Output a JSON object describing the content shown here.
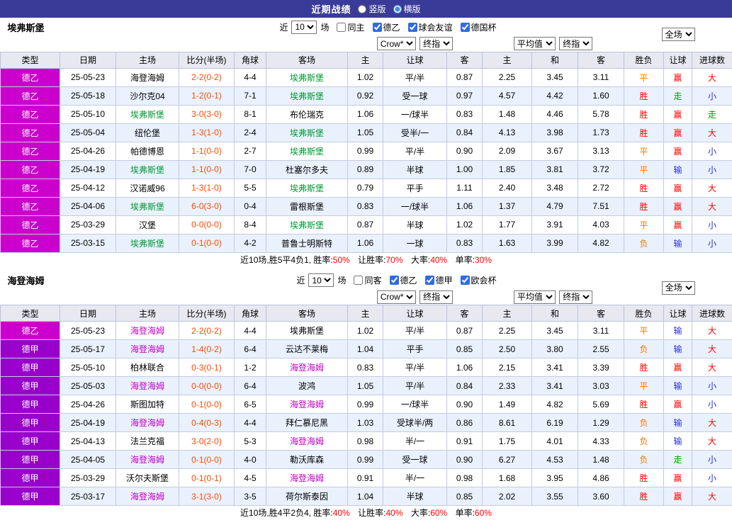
{
  "topbar": {
    "title": "近期战绩",
    "vertical_label": "竖版",
    "vertical_checked": false,
    "horizontal_label": "横版",
    "horizontal_checked": true
  },
  "controls": {
    "near_label": "近",
    "count_value": "10",
    "matches_label": "场",
    "bookmaker_select": "Crow*",
    "final_odds_select": "终指",
    "average_select": "平均值",
    "scope_select": "全场"
  },
  "columns": [
    "类型",
    "日期",
    "主场",
    "比分(半场)",
    "角球",
    "客场",
    "主",
    "让球",
    "客",
    "主",
    "和",
    "客",
    "胜负",
    "让球",
    "进球数"
  ],
  "sections": [
    {
      "team": "埃弗斯堡",
      "filters": [
        {
          "label": "同主",
          "checked": false
        },
        {
          "label": "德乙",
          "checked": true
        },
        {
          "label": "球会友谊",
          "checked": true
        },
        {
          "label": "德国杯",
          "checked": true
        }
      ],
      "rows": [
        {
          "league": "德乙",
          "league_cls": "lg-de2",
          "date": "25-05-23",
          "home": "海登海姆",
          "home_cls": "",
          "score": "2-2(0-2)",
          "corners": "4-4",
          "away": "埃弗斯堡",
          "away_cls": "t-green",
          "ah_home": "1.02",
          "ah_line": "平/半",
          "ah_away": "0.87",
          "eu_home": "2.25",
          "eu_draw": "3.45",
          "eu_away": "3.11",
          "result": "平",
          "result_cls": "c-orange",
          "hcp": "赢",
          "hcp_cls": "c-red",
          "goals": "大",
          "goals_cls": "c-red"
        },
        {
          "league": "德乙",
          "league_cls": "lg-de2",
          "date": "25-05-18",
          "home": "沙尔克04",
          "home_cls": "",
          "score": "1-2(0-1)",
          "corners": "7-1",
          "away": "埃弗斯堡",
          "away_cls": "t-green",
          "ah_home": "0.92",
          "ah_line": "受一球",
          "ah_away": "0.97",
          "eu_home": "4.57",
          "eu_draw": "4.42",
          "eu_away": "1.60",
          "result": "胜",
          "result_cls": "c-red",
          "hcp": "走",
          "hcp_cls": "c-green",
          "goals": "小",
          "goals_cls": "c-blue"
        },
        {
          "league": "德乙",
          "league_cls": "lg-de2",
          "date": "25-05-10",
          "home": "埃弗斯堡",
          "home_cls": "t-green",
          "score": "3-0(3-0)",
          "corners": "8-1",
          "away": "布伦瑞克",
          "away_cls": "",
          "ah_home": "1.06",
          "ah_line": "一/球半",
          "ah_away": "0.83",
          "eu_home": "1.48",
          "eu_draw": "4.46",
          "eu_away": "5.78",
          "result": "胜",
          "result_cls": "c-red",
          "hcp": "赢",
          "hcp_cls": "c-red",
          "goals": "走",
          "goals_cls": "c-green"
        },
        {
          "league": "德乙",
          "league_cls": "lg-de2",
          "date": "25-05-04",
          "home": "纽伦堡",
          "home_cls": "",
          "score": "1-3(1-0)",
          "corners": "2-4",
          "away": "埃弗斯堡",
          "away_cls": "t-green",
          "ah_home": "1.05",
          "ah_line": "受半/一",
          "ah_away": "0.84",
          "eu_home": "4.13",
          "eu_draw": "3.98",
          "eu_away": "1.73",
          "result": "胜",
          "result_cls": "c-red",
          "hcp": "赢",
          "hcp_cls": "c-red",
          "goals": "大",
          "goals_cls": "c-red"
        },
        {
          "league": "德乙",
          "league_cls": "lg-de2",
          "date": "25-04-26",
          "home": "帕德博恩",
          "home_cls": "",
          "score": "1-1(0-0)",
          "corners": "2-7",
          "away": "埃弗斯堡",
          "away_cls": "t-green",
          "ah_home": "0.99",
          "ah_line": "平/半",
          "ah_away": "0.90",
          "eu_home": "2.09",
          "eu_draw": "3.67",
          "eu_away": "3.13",
          "result": "平",
          "result_cls": "c-orange",
          "hcp": "赢",
          "hcp_cls": "c-red",
          "goals": "小",
          "goals_cls": "c-blue"
        },
        {
          "league": "德乙",
          "league_cls": "lg-de2",
          "date": "25-04-19",
          "home": "埃弗斯堡",
          "home_cls": "t-green",
          "score": "1-1(0-0)",
          "corners": "7-0",
          "away": "杜塞尔多夫",
          "away_cls": "",
          "ah_home": "0.89",
          "ah_line": "半球",
          "ah_away": "1.00",
          "eu_home": "1.85",
          "eu_draw": "3.81",
          "eu_away": "3.72",
          "result": "平",
          "result_cls": "c-orange",
          "hcp": "输",
          "hcp_cls": "c-blue",
          "goals": "小",
          "goals_cls": "c-blue"
        },
        {
          "league": "德乙",
          "league_cls": "lg-de2",
          "date": "25-04-12",
          "home": "汉诺威96",
          "home_cls": "",
          "score": "1-3(1-0)",
          "corners": "5-5",
          "away": "埃弗斯堡",
          "away_cls": "t-green",
          "ah_home": "0.79",
          "ah_line": "平手",
          "ah_away": "1.11",
          "eu_home": "2.40",
          "eu_draw": "3.48",
          "eu_away": "2.72",
          "result": "胜",
          "result_cls": "c-red",
          "hcp": "赢",
          "hcp_cls": "c-red",
          "goals": "大",
          "goals_cls": "c-red"
        },
        {
          "league": "德乙",
          "league_cls": "lg-de2",
          "date": "25-04-06",
          "home": "埃弗斯堡",
          "home_cls": "t-green",
          "score": "6-0(3-0)",
          "corners": "0-4",
          "away": "雷根斯堡",
          "away_cls": "",
          "ah_home": "0.83",
          "ah_line": "一/球半",
          "ah_away": "1.06",
          "eu_home": "1.37",
          "eu_draw": "4.79",
          "eu_away": "7.51",
          "result": "胜",
          "result_cls": "c-red",
          "hcp": "赢",
          "hcp_cls": "c-red",
          "goals": "大",
          "goals_cls": "c-red"
        },
        {
          "league": "德乙",
          "league_cls": "lg-de2",
          "date": "25-03-29",
          "home": "汉堡",
          "home_cls": "",
          "score": "0-0(0-0)",
          "corners": "8-4",
          "away": "埃弗斯堡",
          "away_cls": "t-green",
          "ah_home": "0.87",
          "ah_line": "半球",
          "ah_away": "1.02",
          "eu_home": "1.77",
          "eu_draw": "3.91",
          "eu_away": "4.03",
          "result": "平",
          "result_cls": "c-orange",
          "hcp": "赢",
          "hcp_cls": "c-red",
          "goals": "小",
          "goals_cls": "c-blue"
        },
        {
          "league": "德乙",
          "league_cls": "lg-de2",
          "date": "25-03-15",
          "home": "埃弗斯堡",
          "home_cls": "t-green",
          "score": "0-1(0-0)",
          "corners": "4-2",
          "away": "普鲁士明斯特",
          "away_cls": "",
          "ah_home": "1.06",
          "ah_line": "一球",
          "ah_away": "0.83",
          "eu_home": "1.63",
          "eu_draw": "3.99",
          "eu_away": "4.82",
          "result": "负",
          "result_cls": "c-orange",
          "hcp": "输",
          "hcp_cls": "c-blue",
          "goals": "小",
          "goals_cls": "c-blue"
        }
      ],
      "summary": {
        "prefix": "近10场,胜5平4负1, 胜率:",
        "win_rate": "50%",
        "hcp_label": "让胜率:",
        "hcp_rate": "70%",
        "big_label": "大率:",
        "big_rate": "40%",
        "odd_label": "单率:",
        "odd_rate": "30%"
      }
    },
    {
      "team": "海登海姆",
      "filters": [
        {
          "label": "同客",
          "checked": false
        },
        {
          "label": "德乙",
          "checked": true
        },
        {
          "label": "德甲",
          "checked": true
        },
        {
          "label": "欧会杯",
          "checked": true
        }
      ],
      "rows": [
        {
          "league": "德乙",
          "league_cls": "lg-de2",
          "date": "25-05-23",
          "home": "海登海姆",
          "home_cls": "t-purple",
          "score": "2-2(0-2)",
          "corners": "4-4",
          "away": "埃弗斯堡",
          "away_cls": "",
          "ah_home": "1.02",
          "ah_line": "平/半",
          "ah_away": "0.87",
          "eu_home": "2.25",
          "eu_draw": "3.45",
          "eu_away": "3.11",
          "result": "平",
          "result_cls": "c-orange",
          "hcp": "输",
          "hcp_cls": "c-blue",
          "goals": "大",
          "goals_cls": "c-red"
        },
        {
          "league": "德甲",
          "league_cls": "lg-de1",
          "date": "25-05-17",
          "home": "海登海姆",
          "home_cls": "t-purple",
          "score": "1-4(0-2)",
          "corners": "6-4",
          "away": "云达不莱梅",
          "away_cls": "",
          "ah_home": "1.04",
          "ah_line": "平手",
          "ah_away": "0.85",
          "eu_home": "2.50",
          "eu_draw": "3.80",
          "eu_away": "2.55",
          "result": "负",
          "result_cls": "c-orange",
          "hcp": "输",
          "hcp_cls": "c-blue",
          "goals": "大",
          "goals_cls": "c-red"
        },
        {
          "league": "德甲",
          "league_cls": "lg-de1",
          "date": "25-05-10",
          "home": "柏林联合",
          "home_cls": "",
          "score": "0-3(0-1)",
          "corners": "1-2",
          "away": "海登海姆",
          "away_cls": "t-purple",
          "ah_home": "0.83",
          "ah_line": "平/半",
          "ah_away": "1.06",
          "eu_home": "2.15",
          "eu_draw": "3.41",
          "eu_away": "3.39",
          "result": "胜",
          "result_cls": "c-red",
          "hcp": "赢",
          "hcp_cls": "c-red",
          "goals": "大",
          "goals_cls": "c-red"
        },
        {
          "league": "德甲",
          "league_cls": "lg-de1",
          "date": "25-05-03",
          "home": "海登海姆",
          "home_cls": "t-purple",
          "score": "0-0(0-0)",
          "corners": "6-4",
          "away": "波鸿",
          "away_cls": "",
          "ah_home": "1.05",
          "ah_line": "平/半",
          "ah_away": "0.84",
          "eu_home": "2.33",
          "eu_draw": "3.41",
          "eu_away": "3.03",
          "result": "平",
          "result_cls": "c-orange",
          "hcp": "输",
          "hcp_cls": "c-blue",
          "goals": "小",
          "goals_cls": "c-blue"
        },
        {
          "league": "德甲",
          "league_cls": "lg-de1",
          "date": "25-04-26",
          "home": "斯图加特",
          "home_cls": "",
          "score": "0-1(0-0)",
          "corners": "6-5",
          "away": "海登海姆",
          "away_cls": "t-purple",
          "ah_home": "0.99",
          "ah_line": "一/球半",
          "ah_away": "0.90",
          "eu_home": "1.49",
          "eu_draw": "4.82",
          "eu_away": "5.69",
          "result": "胜",
          "result_cls": "c-red",
          "hcp": "赢",
          "hcp_cls": "c-red",
          "goals": "小",
          "goals_cls": "c-blue"
        },
        {
          "league": "德甲",
          "league_cls": "lg-de1",
          "date": "25-04-19",
          "home": "海登海姆",
          "home_cls": "t-purple",
          "score": "0-4(0-3)",
          "corners": "4-4",
          "away": "拜仁慕尼黑",
          "away_cls": "",
          "ah_home": "1.03",
          "ah_line": "受球半/两",
          "ah_away": "0.86",
          "eu_home": "8.61",
          "eu_draw": "6.19",
          "eu_away": "1.29",
          "result": "负",
          "result_cls": "c-orange",
          "hcp": "输",
          "hcp_cls": "c-blue",
          "goals": "大",
          "goals_cls": "c-red"
        },
        {
          "league": "德甲",
          "league_cls": "lg-de1",
          "date": "25-04-13",
          "home": "法兰克福",
          "home_cls": "",
          "score": "3-0(2-0)",
          "corners": "5-3",
          "away": "海登海姆",
          "away_cls": "t-purple",
          "ah_home": "0.98",
          "ah_line": "半/一",
          "ah_away": "0.91",
          "eu_home": "1.75",
          "eu_draw": "4.01",
          "eu_away": "4.33",
          "result": "负",
          "result_cls": "c-orange",
          "hcp": "输",
          "hcp_cls": "c-blue",
          "goals": "大",
          "goals_cls": "c-red"
        },
        {
          "league": "德甲",
          "league_cls": "lg-de1",
          "date": "25-04-05",
          "home": "海登海姆",
          "home_cls": "t-purple",
          "score": "0-1(0-0)",
          "corners": "4-0",
          "away": "勒沃库森",
          "away_cls": "",
          "ah_home": "0.99",
          "ah_line": "受一球",
          "ah_away": "0.90",
          "eu_home": "6.27",
          "eu_draw": "4.53",
          "eu_away": "1.48",
          "result": "负",
          "result_cls": "c-orange",
          "hcp": "走",
          "hcp_cls": "c-green",
          "goals": "小",
          "goals_cls": "c-blue"
        },
        {
          "league": "德甲",
          "league_cls": "lg-de1",
          "date": "25-03-29",
          "home": "沃尔夫斯堡",
          "home_cls": "",
          "score": "0-1(0-1)",
          "corners": "4-5",
          "away": "海登海姆",
          "away_cls": "t-purple",
          "ah_home": "0.91",
          "ah_line": "半/一",
          "ah_away": "0.98",
          "eu_home": "1.68",
          "eu_draw": "3.95",
          "eu_away": "4.86",
          "result": "胜",
          "result_cls": "c-red",
          "hcp": "赢",
          "hcp_cls": "c-red",
          "goals": "小",
          "goals_cls": "c-blue"
        },
        {
          "league": "德甲",
          "league_cls": "lg-de1",
          "date": "25-03-17",
          "home": "海登海姆",
          "home_cls": "t-purple",
          "score": "3-1(3-0)",
          "corners": "3-5",
          "away": "荷尔斯泰因",
          "away_cls": "",
          "ah_home": "1.04",
          "ah_line": "半球",
          "ah_away": "0.85",
          "eu_home": "2.02",
          "eu_draw": "3.55",
          "eu_away": "3.60",
          "result": "胜",
          "result_cls": "c-red",
          "hcp": "赢",
          "hcp_cls": "c-red",
          "goals": "大",
          "goals_cls": "c-red"
        }
      ],
      "summary": {
        "prefix": "近10场,胜4平2负4, 胜率:",
        "win_rate": "40%",
        "hcp_label": "让胜率:",
        "hcp_rate": "40%",
        "big_label": "大率:",
        "big_rate": "60%",
        "odd_label": "单率:",
        "odd_rate": "60%"
      }
    }
  ]
}
